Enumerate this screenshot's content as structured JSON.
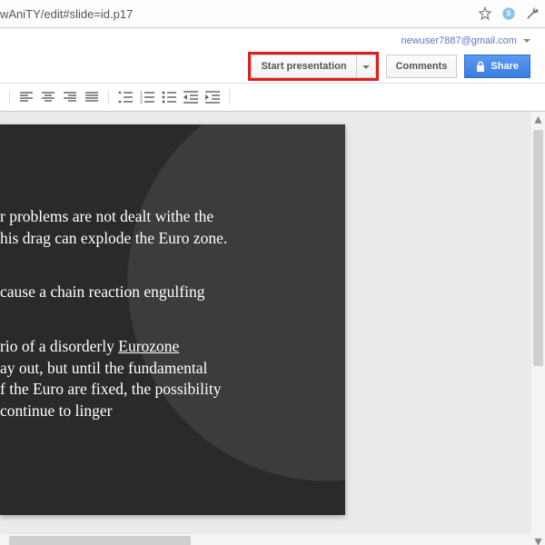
{
  "address_bar": {
    "url": "wAniTY/edit#slide=id.p17"
  },
  "header": {
    "email": "newuser7887@gmail.com",
    "start_presentation": "Start presentation",
    "comments": "Comments",
    "share": "Share"
  },
  "slide": {
    "p1a": "r problems are not dealt withe the ",
    "p1b": "his drag can explode the Euro zone.",
    "p2": " cause a chain reaction engulfing ",
    "p3a": "rio of a disorderly ",
    "p3a_eurozone": "Eurozone",
    "p3b": "ay out, but until the fundamental ",
    "p3c": "f the Euro are fixed, the possibility ",
    "p3d": " continue to linger"
  }
}
